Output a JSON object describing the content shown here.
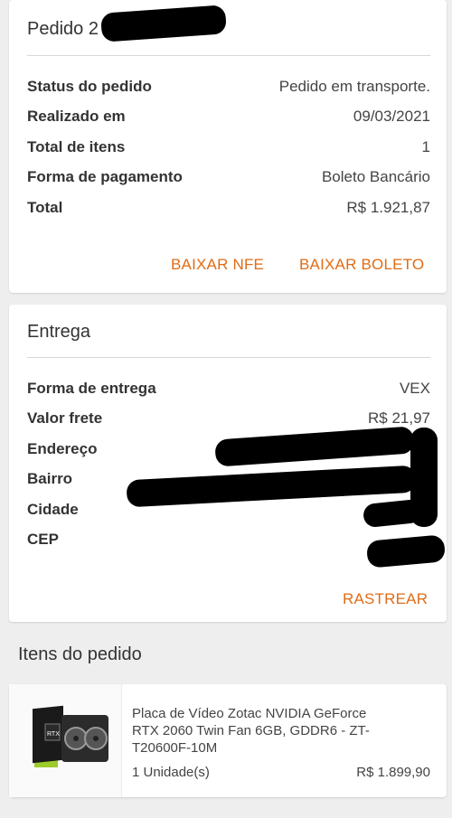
{
  "order": {
    "title": "Pedido 2",
    "rows": [
      {
        "label": "Status do pedido",
        "value": "Pedido em transporte."
      },
      {
        "label": "Realizado em",
        "value": "09/03/2021"
      },
      {
        "label": "Total de itens",
        "value": "1"
      },
      {
        "label": "Forma de pagamento",
        "value": "Boleto Bancário"
      },
      {
        "label": "Total",
        "value": "R$ 1.921,87"
      }
    ],
    "actions": {
      "download_nfe": "BAIXAR NFE",
      "download_boleto": "BAIXAR BOLETO"
    }
  },
  "delivery": {
    "title": "Entrega",
    "rows": [
      {
        "label": "Forma de entrega",
        "value": "VEX"
      },
      {
        "label": "Valor frete",
        "value": "R$ 21,97"
      },
      {
        "label": "Endereço",
        "value": ""
      },
      {
        "label": "Bairro",
        "value": ""
      },
      {
        "label": "Cidade",
        "value": ""
      },
      {
        "label": "CEP",
        "value": ""
      }
    ],
    "actions": {
      "track": "RASTREAR"
    }
  },
  "items_section": {
    "heading": "Itens do pedido",
    "items": [
      {
        "name": "Placa de Vídeo Zotac NVIDIA GeForce RTX 2060 Twin Fan 6GB, GDDR6 - ZT-T20600F-10M",
        "quantity": "1 Unidade(s)",
        "price": "R$ 1.899,90",
        "image_label": "RTX"
      }
    ]
  },
  "colors": {
    "accent": "#e06c16",
    "background": "#eeeeee",
    "card": "#ffffff",
    "redaction": "#000000"
  }
}
